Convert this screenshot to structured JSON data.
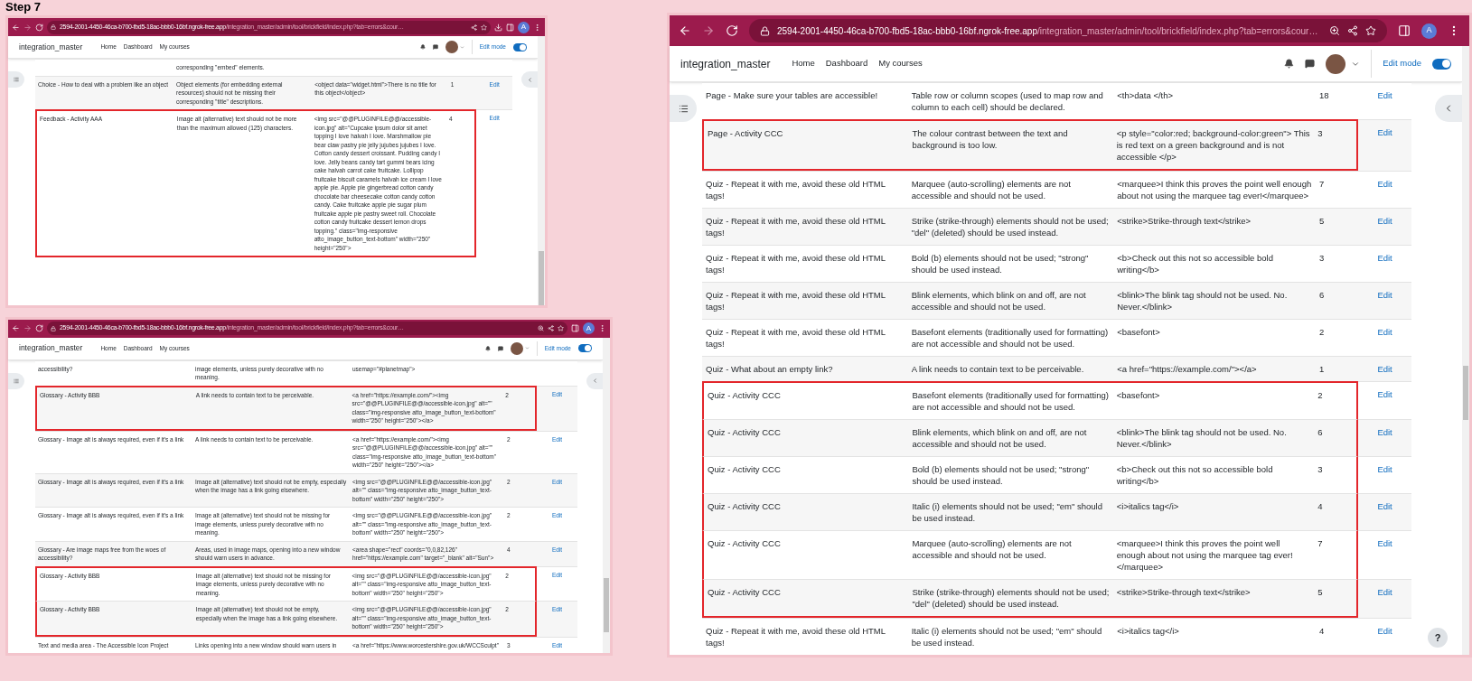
{
  "heading": "Step 7",
  "windows": [
    {
      "url_host": "2594-2001-4450-46ca-b700-fbd5-18ac-bbb0-16bf.ngrok-free.app",
      "url_path": "/integration_master/admin/tool/brickfield/index.php?tab=errors&cour…",
      "forward_enabled": false,
      "address_icons": [
        {
          "kind": "share"
        },
        {
          "kind": "star"
        }
      ],
      "toolbar_icons": [
        {
          "kind": "download"
        },
        {
          "kind": "sidebar"
        }
      ],
      "profile_initial": "A",
      "site_name": "integration_master",
      "nav": [
        "Home",
        "Dashboard",
        "My courses"
      ],
      "edit_mode": {
        "label": "Edit mode",
        "on": true
      },
      "rows": [
        {
          "error": "corresponding \"embed\" elements.",
          "flagged": false
        },
        {
          "activity": "Choice - How to deal with a problem like an object",
          "error": "Object elements (for embedding external resources) should not be missing their corresponding \"title\" descriptions.",
          "html": "<object data=\"widget.html\">There is no title for this object</object>",
          "count": "1",
          "action": "Edit",
          "flagged": false
        },
        {
          "activity": "Feedback - Activity AAA",
          "error": "Image alt (alternative) text should not be more than the maximum allowed (125) characters.",
          "html": "<img src=\"@@PLUGINFILE@@/accessible-icon.jpg\" alt=\"Cupcake ipsum dolor sit amet topping I love halvah I love. Marshmallow pie bear claw pastry pie jelly jujubes jujubes I love. Cotton candy dessert croissant. Pudding candy I love. Jelly beans candy tart gummi bears icing cake halvah carrot cake fruitcake. Lollipop fruitcake biscuit caramels halvah ice cream I love apple pie. Apple pie gingerbread cotton candy chocolate bar cheesecake cotton candy cotton candy. Cake fruitcake apple pie sugar plum fruitcake apple pie pastry sweet roll. Chocolate cotton candy fruitcake dessert lemon drops topping.\" class=\"img-responsive atto_image_button_text-bottom\" width=\"250\" height=\"250\">",
          "count": "4",
          "action": "Edit",
          "flagged": true
        }
      ]
    },
    {
      "url_host": "2594-2001-4450-46ca-b700-fbd5-18ac-bbb0-16bf.ngrok-free.app",
      "url_path": "/integration_master/admin/tool/brickfield/index.php?tab=errors&cour…",
      "forward_enabled": false,
      "address_icons": [
        {
          "kind": "zoom"
        },
        {
          "kind": "share"
        },
        {
          "kind": "star"
        }
      ],
      "toolbar_icons": [
        {
          "kind": "sidebar"
        }
      ],
      "profile_initial": "A",
      "site_name": "integration_master",
      "nav": [
        "Home",
        "Dashboard",
        "My courses"
      ],
      "edit_mode": {
        "label": "Edit mode",
        "on": true
      },
      "rows": [
        {
          "activity": "accessibility?",
          "error": "image elements, unless purely decorative with no meaning.",
          "html": "usemap=\"#planetmap\">",
          "flagged": false
        },
        {
          "activity": "Glossary - Activity BBB",
          "error": "A link needs to contain text to be perceivable.",
          "html": "<a href=\"https://example.com/\"><img src=\"@@PLUGINFILE@@/accessible-icon.jpg\" alt=\"\" class=\"img-responsive atto_image_button_text-bottom\" width=\"250\" height=\"250\"></a>",
          "count": "2",
          "action": "Edit",
          "flagged": true
        },
        {
          "activity": "Glossary - Image alt is always required, even if it's a link",
          "error": "A link needs to contain text to be perceivable.",
          "html": "<a href=\"https://example.com/\"><img src=\"@@PLUGINFILE@@/accessible-icon.jpg\" alt=\"\" class=\"img-responsive atto_image_button_text-bottom\" width=\"250\" height=\"250\"></a>",
          "count": "2",
          "action": "Edit",
          "flagged": false
        },
        {
          "activity": "Glossary - Image alt is always required, even if it's a link",
          "error": "Image alt (alternative) text should not be empty, especially when the image has a link going elsewhere.",
          "html": "<img src=\"@@PLUGINFILE@@/accessible-icon.jpg\" alt=\"\" class=\"img-responsive atto_image_button_text-bottom\" width=\"250\" height=\"250\">",
          "count": "2",
          "action": "Edit",
          "flagged": false
        },
        {
          "activity": "Glossary - Image alt is always required, even if it's a link",
          "error": "Image alt (alternative) text should not be missing for image elements, unless purely decorative with no meaning.",
          "html": "<img src=\"@@PLUGINFILE@@/accessible-icon.jpg\" alt=\"\" class=\"img-responsive atto_image_button_text-bottom\" width=\"250\" height=\"250\">",
          "count": "2",
          "action": "Edit",
          "flagged": false
        },
        {
          "activity": "Glossary - Are image maps free from the woes of accessibility?",
          "error": "Areas, used in image maps, opening into a new window should warn users in advance.",
          "html": "<area shape=\"rect\" coords=\"0,0,82,126\" href=\"https://example.com\" target=\"_blank\" alt=\"Sun\">",
          "count": "4",
          "action": "Edit",
          "flagged": false
        },
        {
          "activity": "Glossary - Activity BBB",
          "error": "Image alt (alternative) text should not be missing for image elements, unless purely decorative with no meaning.",
          "html": "<img src=\"@@PLUGINFILE@@/accessible-icon.jpg\" alt=\"\" class=\"img-responsive atto_image_button_text-bottom\" width=\"250\" height=\"250\">",
          "count": "2",
          "action": "Edit",
          "flagged": true
        },
        {
          "activity": "Glossary - Activity BBB",
          "error": "Image alt (alternative) text should not be empty, especially when the image has a link going elsewhere.",
          "html": "<img src=\"@@PLUGINFILE@@/accessible-icon.jpg\" alt=\"\" class=\"img-responsive atto_image_button_text-bottom\" width=\"250\" height=\"250\">",
          "count": "2",
          "action": "Edit",
          "flagged": true
        },
        {
          "activity": "Text and media area - The Accessible Icon Project",
          "error": "Links opening into a new window should warn users in",
          "html": "<a href=\"https://www.worcestershire.gov.uk/WCCSculpt\"",
          "count": "3",
          "action": "Edit",
          "flagged": false
        }
      ]
    },
    {
      "url_host": "2594-2001-4450-46ca-b700-fbd5-18ac-bbb0-16bf.ngrok-free.app",
      "url_path": "/integration_master/admin/tool/brickfield/index.php?tab=errors&cour…",
      "forward_enabled": false,
      "address_icons": [
        {
          "kind": "zoom"
        },
        {
          "kind": "share"
        },
        {
          "kind": "star"
        }
      ],
      "toolbar_icons": [
        {
          "kind": "sidebar"
        }
      ],
      "profile_initial": "A",
      "site_name": "integration_master",
      "nav": [
        "Home",
        "Dashboard",
        "My courses"
      ],
      "edit_mode": {
        "label": "Edit mode",
        "on": true
      },
      "help": "?",
      "rows": [
        {
          "activity": "Page - Make sure your tables are accessible!",
          "error": "Table row or column scopes (used to map row and column to each cell) should be declared.",
          "html": "<th>data </th>",
          "count": "18",
          "action": "Edit",
          "flagged": false
        },
        {
          "activity": "Page - Activity CCC",
          "error": "The colour contrast between the text and background is too low.",
          "html": "<p style=\"color:red; background-color:green\"> This is red text on a green background and is not accessible </p>",
          "count": "3",
          "action": "Edit",
          "flagged": true
        },
        {
          "activity": "Quiz - Repeat it with me, avoid these old HTML tags!",
          "error": "Marquee (auto-scrolling) elements are not accessible and should not be used.",
          "html": "<marquee>I think this proves the point well enough about not using the marquee tag ever!</marquee>",
          "count": "7",
          "action": "Edit",
          "flagged": false
        },
        {
          "activity": "Quiz - Repeat it with me, avoid these old HTML tags!",
          "error": "Strike (strike-through) elements should not be used; \"del\" (deleted) should be used instead.",
          "html": "<strike>Strike-through text</strike>",
          "count": "5",
          "action": "Edit",
          "flagged": false
        },
        {
          "activity": "Quiz - Repeat it with me, avoid these old HTML tags!",
          "error": "Bold (b) elements should not be used; \"strong\" should be used instead.",
          "html": "<b>Check out this not so accessible bold writing</b>",
          "count": "3",
          "action": "Edit",
          "flagged": false
        },
        {
          "activity": "Quiz - Repeat it with me, avoid these old HTML tags!",
          "error": "Blink elements, which blink on and off, are not accessible and should not be used.",
          "html": "<blink>The blink tag should not be used. No. Never.</blink>",
          "count": "6",
          "action": "Edit",
          "flagged": false
        },
        {
          "activity": "Quiz - Repeat it with me, avoid these old HTML tags!",
          "error": "Basefont elements (traditionally used for formatting) are not accessible and should not be used.",
          "html": "<basefont>",
          "count": "2",
          "action": "Edit",
          "flagged": false
        },
        {
          "activity": "Quiz - What about an empty link?",
          "error": "A link needs to contain text to be perceivable.",
          "html": "<a href=\"https://example.com/\"></a>",
          "count": "1",
          "action": "Edit",
          "flagged": false
        },
        {
          "activity": "Quiz - Activity CCC",
          "error": "Basefont elements (traditionally used for formatting) are not accessible and should not be used.",
          "html": "<basefont>",
          "count": "2",
          "action": "Edit",
          "flagged": true
        },
        {
          "activity": "Quiz - Activity CCC",
          "error": "Blink elements, which blink on and off, are not accessible and should not be used.",
          "html": "<blink>The blink tag should not be used. No. Never.</blink>",
          "count": "6",
          "action": "Edit",
          "flagged": true
        },
        {
          "activity": "Quiz - Activity CCC",
          "error": "Bold (b) elements should not be used; \"strong\" should be used instead.",
          "html": "<b>Check out this not so accessible bold writing</b>",
          "count": "3",
          "action": "Edit",
          "flagged": true
        },
        {
          "activity": "Quiz - Activity CCC",
          "error": "Italic (i) elements should not be used; \"em\" should be used instead.",
          "html": "<i>italics tag</i>",
          "count": "4",
          "action": "Edit",
          "flagged": true
        },
        {
          "activity": "Quiz - Activity CCC",
          "error": "Marquee (auto-scrolling) elements are not accessible and should not be used.",
          "html": "<marquee>I think this proves the point well enough about not using the marquee tag ever!</marquee>",
          "count": "7",
          "action": "Edit",
          "flagged": true
        },
        {
          "activity": "Quiz - Activity CCC",
          "error": "Strike (strike-through) elements should not be used; \"del\" (deleted) should be used instead.",
          "html": "<strike>Strike-through text</strike>",
          "count": "5",
          "action": "Edit",
          "flagged": true
        },
        {
          "activity": "Quiz - Repeat it with me, avoid these old HTML tags!",
          "error": "Italic (i) elements should not be used; \"em\" should be used instead.",
          "html": "<i>italics tag</i>",
          "count": "4",
          "action": "Edit",
          "flagged": false
        }
      ]
    }
  ]
}
